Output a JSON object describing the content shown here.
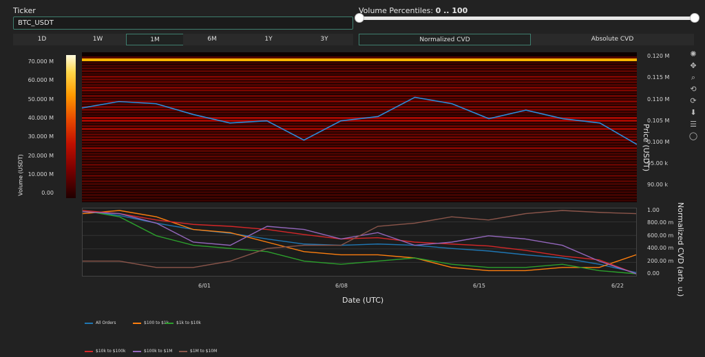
{
  "controls": {
    "ticker_label": "Ticker",
    "ticker_value": "BTC_USDT",
    "volume_percentiles_label": "Volume Percentiles:",
    "volume_percentiles_value": "0 .. 100",
    "slider_min": 0,
    "slider_max": 100,
    "timeframes": [
      "1D",
      "1W",
      "1M",
      "6M",
      "1Y",
      "3Y"
    ],
    "active_timeframe": "1M",
    "modes": [
      "Normalized CVD",
      "Absolute CVD"
    ],
    "active_mode": "Normalized CVD"
  },
  "heatmap": {
    "colorbar_ticks": [
      "70.000 M",
      "60.000 M",
      "50.000 M",
      "40.000 M",
      "30.000 M",
      "20.000 M",
      "10.000 M",
      "0.00"
    ],
    "colorbar_title": "Volume (USDT)",
    "price_ticks": [
      "0.120 M",
      "0.115 M",
      "0.110 M",
      "0.105 M",
      "0.100 M",
      "95.00 k",
      "90.00 k"
    ],
    "price_title": "Price (USDT)"
  },
  "cvd": {
    "y_ticks": [
      "1.00",
      "800.00 m",
      "600.00 m",
      "400.00 m",
      "200.00 m",
      "0.00"
    ],
    "y_title": "Normalized CVD (arb. u.)",
    "x_ticks": [
      "6/01",
      "6/08",
      "6/15",
      "6/22"
    ],
    "x_title": "Date (UTC)"
  },
  "legend": [
    {
      "name": "All Orders",
      "color": "#1f77b4"
    },
    {
      "name": "$100 to $1k",
      "color": "#ff7f0e"
    },
    {
      "name": "$1k to $10k",
      "color": "#2ca02c"
    },
    {
      "name": "$10k to $100k",
      "color": "#d62728"
    },
    {
      "name": "$100k to $1M",
      "color": "#9467bd"
    },
    {
      "name": "$1M to $10M",
      "color": "#8c564b"
    }
  ],
  "toolbar_icons": [
    "plotly-logo-icon",
    "pan-icon",
    "zoom-icon",
    "lasso-icon",
    "reset-icon",
    "download-icon",
    "compare-icon",
    "autoscale-icon"
  ],
  "chart_data": [
    {
      "type": "line",
      "title": "",
      "xlabel": "Date (UTC)",
      "ylabel": "Price (USDT)",
      "x": [
        "5/24",
        "5/26",
        "5/28",
        "5/30",
        "6/01",
        "6/03",
        "6/05",
        "6/07",
        "6/09",
        "6/11",
        "6/13",
        "6/15",
        "6/17",
        "6/19",
        "6/21",
        "6/23"
      ],
      "series": [
        {
          "name": "Price",
          "values": [
            108000,
            109500,
            109000,
            106500,
            104500,
            105000,
            100500,
            105000,
            106000,
            110500,
            109000,
            105500,
            107500,
            105500,
            104500,
            99500
          ]
        }
      ],
      "ylim": [
        86000,
        121000
      ]
    },
    {
      "type": "line",
      "title": "",
      "xlabel": "Date (UTC)",
      "ylabel": "Normalized CVD (arb. u.)",
      "x_ticks": [
        "6/01",
        "6/08",
        "6/15",
        "6/22"
      ],
      "ylim": [
        0,
        1
      ],
      "series": [
        {
          "name": "All Orders",
          "values": [
            1.0,
            0.92,
            0.8,
            0.7,
            0.64,
            0.55,
            0.47,
            0.45,
            0.47,
            0.45,
            0.4,
            0.36,
            0.3,
            0.25,
            0.15,
            0.02
          ]
        },
        {
          "name": "$100 to $1k",
          "values": [
            0.95,
            1.0,
            0.9,
            0.7,
            0.65,
            0.5,
            0.35,
            0.3,
            0.3,
            0.25,
            0.1,
            0.05,
            0.05,
            0.1,
            0.1,
            0.3
          ]
        },
        {
          "name": "$1k to $10k",
          "values": [
            1.0,
            0.9,
            0.6,
            0.45,
            0.4,
            0.35,
            0.2,
            0.15,
            0.2,
            0.25,
            0.15,
            0.1,
            0.1,
            0.15,
            0.05,
            0.0
          ]
        },
        {
          "name": "$10k to $100k",
          "values": [
            1.0,
            0.95,
            0.85,
            0.78,
            0.75,
            0.7,
            0.62,
            0.55,
            0.57,
            0.5,
            0.47,
            0.44,
            0.37,
            0.28,
            0.22,
            0.0
          ]
        },
        {
          "name": "$100k to $1M",
          "values": [
            0.98,
            0.95,
            0.8,
            0.5,
            0.45,
            0.75,
            0.7,
            0.55,
            0.65,
            0.45,
            0.5,
            0.6,
            0.55,
            0.45,
            0.2,
            0.0
          ]
        },
        {
          "name": "$1M to $10M",
          "values": [
            0.2,
            0.2,
            0.1,
            0.1,
            0.2,
            0.4,
            0.45,
            0.45,
            0.75,
            0.8,
            0.9,
            0.85,
            0.95,
            1.0,
            0.97,
            0.95
          ]
        }
      ]
    }
  ]
}
